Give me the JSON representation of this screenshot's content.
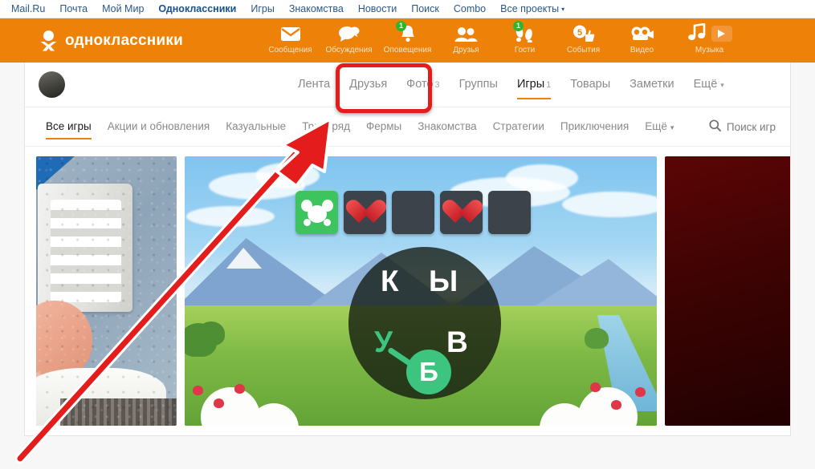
{
  "mailru_bar": {
    "links": [
      {
        "label": "Mail.Ru",
        "bold": false
      },
      {
        "label": "Почта",
        "bold": false
      },
      {
        "label": "Мой Мир",
        "bold": false
      },
      {
        "label": "Одноклассники",
        "bold": true
      },
      {
        "label": "Игры",
        "bold": false
      },
      {
        "label": "Знакомства",
        "bold": false
      },
      {
        "label": "Новости",
        "bold": false
      },
      {
        "label": "Поиск",
        "bold": false
      },
      {
        "label": "Combo",
        "bold": false
      }
    ],
    "all_projects": "Все проекты",
    "caret": "▾"
  },
  "header": {
    "logo_text": "одноклассники",
    "brand_color": "#ee8208",
    "badge_color": "#2db62d",
    "nav": [
      {
        "label": "Сообщения",
        "icon": "envelope-icon",
        "badge": ""
      },
      {
        "label": "Обсуждения",
        "icon": "chat-bubbles-icon",
        "badge": ""
      },
      {
        "label": "Оповещения",
        "icon": "bell-icon",
        "badge": "1"
      },
      {
        "label": "Друзья",
        "icon": "friends-icon",
        "badge": ""
      },
      {
        "label": "Гости",
        "icon": "footsteps-icon",
        "badge": "1"
      },
      {
        "label": "События",
        "icon": "coin-thumbsup-icon",
        "badge": ""
      },
      {
        "label": "Видео",
        "icon": "video-camera-icon",
        "badge": ""
      },
      {
        "label": "Музыка",
        "icon": "music-note-icon",
        "badge": ""
      }
    ],
    "play_button": "play-icon"
  },
  "profile_tabs": {
    "accent_color": "#ee8208",
    "items": [
      {
        "label": "Лента",
        "count": "",
        "active": false
      },
      {
        "label": "Друзья",
        "count": "",
        "active": false
      },
      {
        "label": "Фото",
        "count": "3",
        "active": false
      },
      {
        "label": "Группы",
        "count": "",
        "active": false
      },
      {
        "label": "Игры",
        "count": "1",
        "active": true
      },
      {
        "label": "Товары",
        "count": "",
        "active": false
      },
      {
        "label": "Заметки",
        "count": "",
        "active": false
      },
      {
        "label": "Ещё",
        "count": "",
        "active": false,
        "caret": "▾"
      }
    ]
  },
  "game_filters": {
    "items": [
      {
        "label": "Все игры",
        "active": true
      },
      {
        "label": "Акции и обновления",
        "active": false
      },
      {
        "label": "Казуальные",
        "active": false
      },
      {
        "label": "Три в ряд",
        "active": false
      },
      {
        "label": "Фермы",
        "active": false
      },
      {
        "label": "Знакомства",
        "active": false
      },
      {
        "label": "Стратегии",
        "active": false
      },
      {
        "label": "Приключения",
        "active": false
      },
      {
        "label": "Ещё",
        "active": false,
        "caret": "▾"
      }
    ],
    "search_label": "Поиск игр",
    "search_icon": "magnifier-icon"
  },
  "games_strip": {
    "tiles": [
      {
        "name": "photo-hands-device-thumbnail",
        "kind": "photo"
      },
      {
        "name": "word-puzzle-game-banner",
        "kind": "banner"
      },
      {
        "name": "dark-red-game-thumbnail",
        "kind": "photo"
      }
    ],
    "word_game": {
      "letters": [
        "К",
        "Ы",
        "У",
        "В"
      ],
      "selected_letter": "Б",
      "slots": [
        "pet",
        "heart",
        "empty",
        "heart",
        "empty"
      ]
    }
  },
  "annotations": {
    "highlight_target": "Фото 3",
    "highlight_color": "#e51c1c",
    "arrow_color": "#e51c1c"
  }
}
